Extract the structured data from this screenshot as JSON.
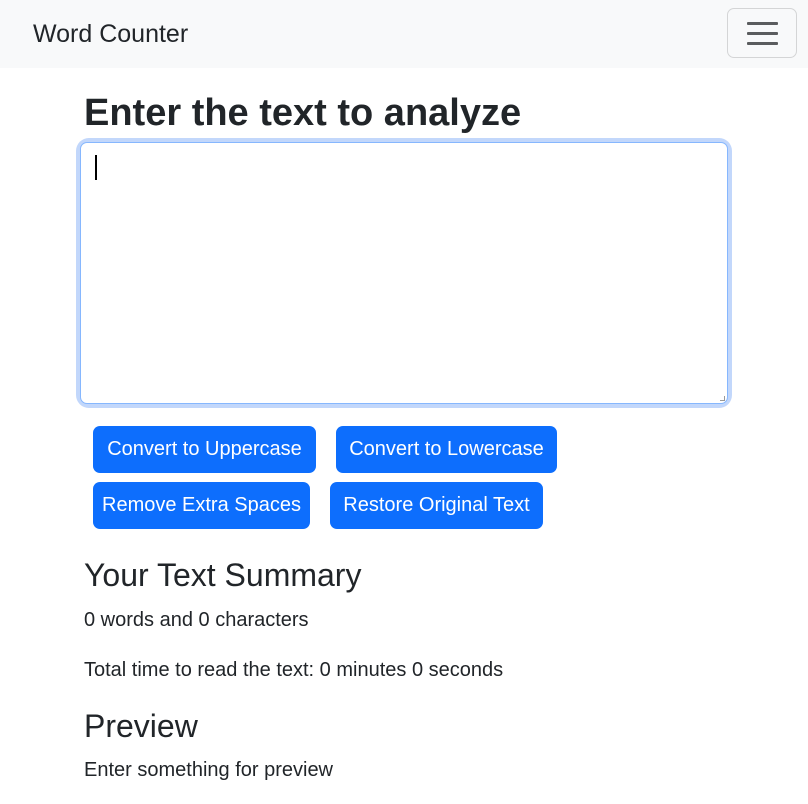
{
  "navbar": {
    "brand": "Word Counter",
    "toggler_icon": "hamburger-menu-icon"
  },
  "main": {
    "heading": "Enter the text to analyze",
    "textarea": {
      "value": "",
      "placeholder": ""
    },
    "buttons": {
      "uppercase": "Convert to Uppercase",
      "lowercase": "Convert to Lowercase",
      "remove_spaces": "Remove Extra Spaces",
      "restore": "Restore Original Text"
    },
    "summary": {
      "heading": "Your Text Summary",
      "counts": "0 words and 0 characters",
      "read_time": "Total time to read the text: 0 minutes 0 seconds"
    },
    "preview": {
      "heading": "Preview",
      "text": "Enter something for preview"
    }
  },
  "colors": {
    "primary_button": "#0d6efd",
    "navbar_bg": "#f8f9fa",
    "focus_ring": "#c2d7fb",
    "text": "#212529"
  }
}
